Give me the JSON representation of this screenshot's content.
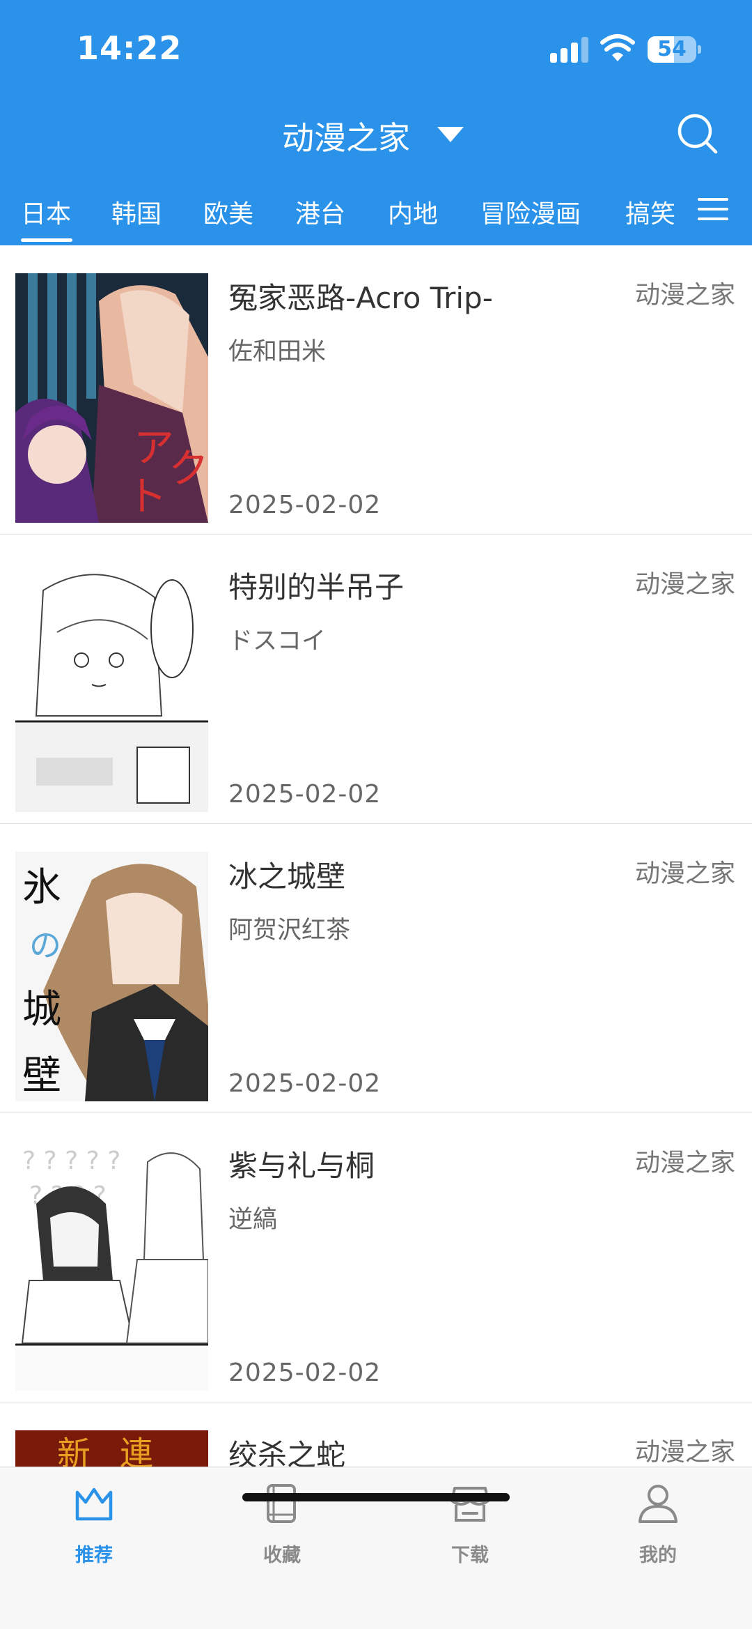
{
  "status_bar": {
    "time": "14:22",
    "battery": "54",
    "battery_level": 0.54
  },
  "header": {
    "title": "动漫之家"
  },
  "tabs": [
    {
      "label": "日本",
      "active": true
    },
    {
      "label": "韩国"
    },
    {
      "label": "欧美"
    },
    {
      "label": "港台"
    },
    {
      "label": "内地"
    },
    {
      "label": "冒险漫画"
    },
    {
      "label": "搞笑"
    }
  ],
  "comics": [
    {
      "title": "冤家恶路-Acro Trip-",
      "author": "佐和田米",
      "date": "2025-02-02",
      "source": "动漫之家"
    },
    {
      "title": "特别的半吊子",
      "author": "ドスコイ",
      "date": "2025-02-02",
      "source": "动漫之家"
    },
    {
      "title": "冰之城壁",
      "author": "阿贺沢红茶",
      "date": "2025-02-02",
      "source": "动漫之家"
    },
    {
      "title": "紫与礼与桐",
      "author": "逆縞",
      "date": "2025-02-02",
      "source": "动漫之家"
    },
    {
      "title": "绞杀之蛇",
      "author": "",
      "date": "",
      "source": "动漫之家"
    }
  ],
  "bottom_nav": [
    {
      "label": "推荐",
      "icon": "crown-icon",
      "active": true
    },
    {
      "label": "收藏",
      "icon": "book-icon"
    },
    {
      "label": "下载",
      "icon": "store-icon"
    },
    {
      "label": "我的",
      "icon": "user-icon"
    }
  ],
  "colors": {
    "primary": "#2b92ea",
    "nav_inactive": "#8a8a8a"
  }
}
